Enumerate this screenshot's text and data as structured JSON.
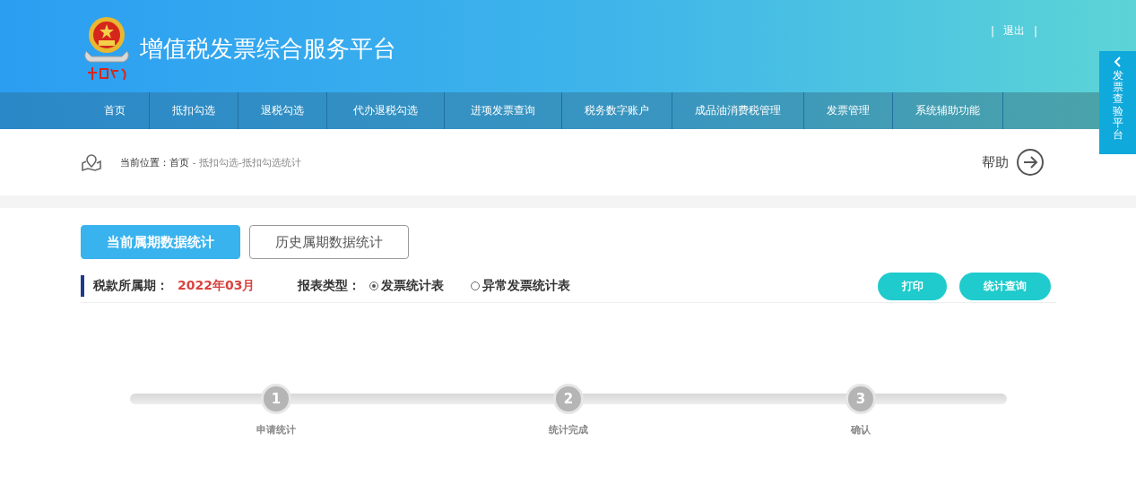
{
  "header": {
    "title": "增值税发票综合服务平台",
    "logout": "退出",
    "divider": "|"
  },
  "nav": [
    {
      "label": "首页"
    },
    {
      "label": "抵扣勾选"
    },
    {
      "label": "退税勾选"
    },
    {
      "label": "代办退税勾选"
    },
    {
      "label": "进项发票查询"
    },
    {
      "label": "税务数字账户"
    },
    {
      "label": "成品油消费税管理"
    },
    {
      "label": "发票管理"
    },
    {
      "label": "系统辅助功能"
    }
  ],
  "side_tab": {
    "label": "发票查验平台"
  },
  "breadcrumb": {
    "prefix": "当前位置：",
    "home": "首页",
    "separator": " - ",
    "path": "抵扣勾选-抵扣勾选统计",
    "help": "帮助"
  },
  "tabs": [
    {
      "label": "当前属期数据统计",
      "selected": true
    },
    {
      "label": "历史属期数据统计",
      "selected": false
    }
  ],
  "filter": {
    "period_label": "税款所属期：",
    "period": "2022年03月",
    "type_label": "报表类型：",
    "types": [
      {
        "label": "发票统计表",
        "selected": true
      },
      {
        "label": "异常发票统计表",
        "selected": false
      }
    ]
  },
  "buttons": [
    "打印",
    "统计查询"
  ],
  "steps": [
    {
      "number": "1",
      "label": "申请统计"
    },
    {
      "number": "2",
      "label": "统计完成"
    },
    {
      "number": "3",
      "label": "确认"
    }
  ]
}
